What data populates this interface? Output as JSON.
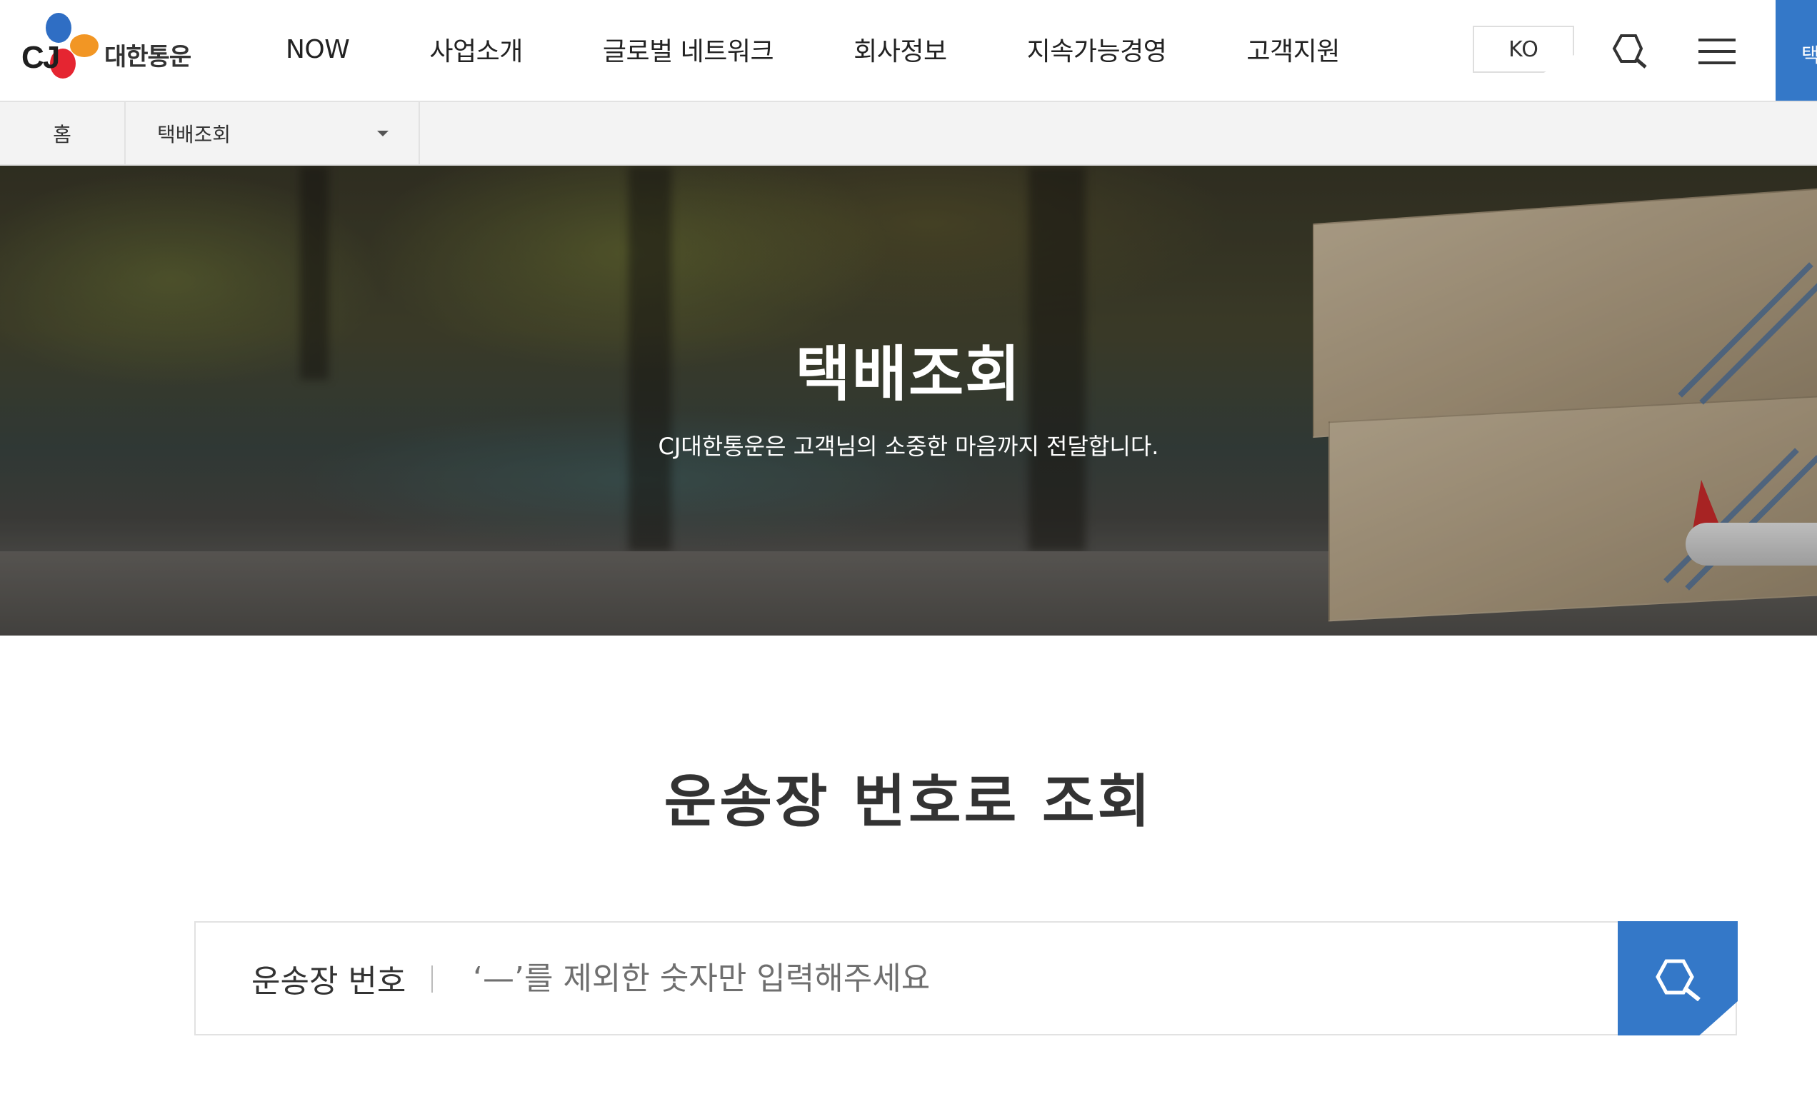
{
  "brand": {
    "logo_mark": "CJ",
    "logo_text": "대한통운"
  },
  "nav": {
    "items": [
      {
        "label": "NOW"
      },
      {
        "label": "사업소개"
      },
      {
        "label": "글로벌 네트워크"
      },
      {
        "label": "회사정보"
      },
      {
        "label": "지속가능경영"
      },
      {
        "label": "고객지원"
      }
    ],
    "lang_label": "KO",
    "search_icon": "search-icon",
    "menu_icon": "hamburger-menu-icon",
    "side_tab_label": "택"
  },
  "breadcrumb": {
    "home": "홈",
    "current": "택배조회"
  },
  "hero": {
    "title": "택배조회",
    "subtitle": "CJ대한통운은 고객님의 소중한 마음까지 전달합니다."
  },
  "tracking": {
    "section_title": "운송장 번호로 조회",
    "field_label": "운송장 번호",
    "placeholder": "‘—’를 제외한 숫자만 입력해주세요",
    "value": ""
  },
  "colors": {
    "accent": "#3478c8",
    "logo_blue": "#2f6ec4",
    "logo_orange": "#f29624",
    "logo_red": "#e52531"
  }
}
